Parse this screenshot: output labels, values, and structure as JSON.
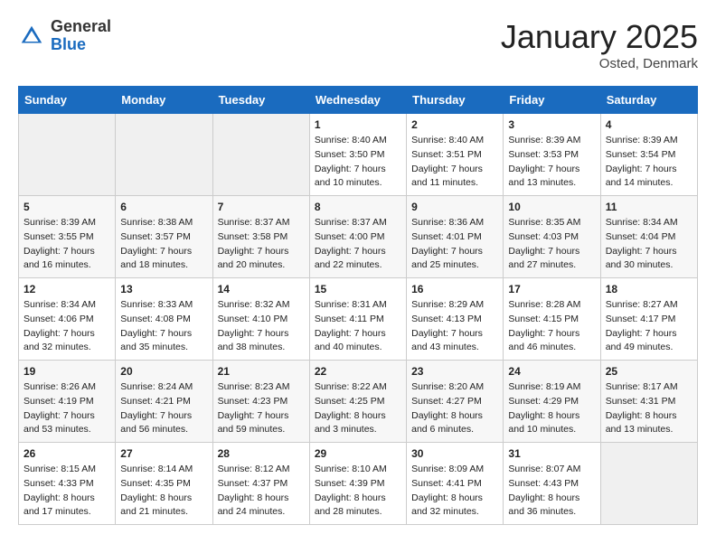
{
  "header": {
    "logo_general": "General",
    "logo_blue": "Blue",
    "month_title": "January 2025",
    "location": "Osted, Denmark"
  },
  "weekdays": [
    "Sunday",
    "Monday",
    "Tuesday",
    "Wednesday",
    "Thursday",
    "Friday",
    "Saturday"
  ],
  "weeks": [
    [
      {
        "day": "",
        "sunrise": "",
        "sunset": "",
        "daylight": ""
      },
      {
        "day": "",
        "sunrise": "",
        "sunset": "",
        "daylight": ""
      },
      {
        "day": "",
        "sunrise": "",
        "sunset": "",
        "daylight": ""
      },
      {
        "day": "1",
        "sunrise": "Sunrise: 8:40 AM",
        "sunset": "Sunset: 3:50 PM",
        "daylight": "Daylight: 7 hours and 10 minutes."
      },
      {
        "day": "2",
        "sunrise": "Sunrise: 8:40 AM",
        "sunset": "Sunset: 3:51 PM",
        "daylight": "Daylight: 7 hours and 11 minutes."
      },
      {
        "day": "3",
        "sunrise": "Sunrise: 8:39 AM",
        "sunset": "Sunset: 3:53 PM",
        "daylight": "Daylight: 7 hours and 13 minutes."
      },
      {
        "day": "4",
        "sunrise": "Sunrise: 8:39 AM",
        "sunset": "Sunset: 3:54 PM",
        "daylight": "Daylight: 7 hours and 14 minutes."
      }
    ],
    [
      {
        "day": "5",
        "sunrise": "Sunrise: 8:39 AM",
        "sunset": "Sunset: 3:55 PM",
        "daylight": "Daylight: 7 hours and 16 minutes."
      },
      {
        "day": "6",
        "sunrise": "Sunrise: 8:38 AM",
        "sunset": "Sunset: 3:57 PM",
        "daylight": "Daylight: 7 hours and 18 minutes."
      },
      {
        "day": "7",
        "sunrise": "Sunrise: 8:37 AM",
        "sunset": "Sunset: 3:58 PM",
        "daylight": "Daylight: 7 hours and 20 minutes."
      },
      {
        "day": "8",
        "sunrise": "Sunrise: 8:37 AM",
        "sunset": "Sunset: 4:00 PM",
        "daylight": "Daylight: 7 hours and 22 minutes."
      },
      {
        "day": "9",
        "sunrise": "Sunrise: 8:36 AM",
        "sunset": "Sunset: 4:01 PM",
        "daylight": "Daylight: 7 hours and 25 minutes."
      },
      {
        "day": "10",
        "sunrise": "Sunrise: 8:35 AM",
        "sunset": "Sunset: 4:03 PM",
        "daylight": "Daylight: 7 hours and 27 minutes."
      },
      {
        "day": "11",
        "sunrise": "Sunrise: 8:34 AM",
        "sunset": "Sunset: 4:04 PM",
        "daylight": "Daylight: 7 hours and 30 minutes."
      }
    ],
    [
      {
        "day": "12",
        "sunrise": "Sunrise: 8:34 AM",
        "sunset": "Sunset: 4:06 PM",
        "daylight": "Daylight: 7 hours and 32 minutes."
      },
      {
        "day": "13",
        "sunrise": "Sunrise: 8:33 AM",
        "sunset": "Sunset: 4:08 PM",
        "daylight": "Daylight: 7 hours and 35 minutes."
      },
      {
        "day": "14",
        "sunrise": "Sunrise: 8:32 AM",
        "sunset": "Sunset: 4:10 PM",
        "daylight": "Daylight: 7 hours and 38 minutes."
      },
      {
        "day": "15",
        "sunrise": "Sunrise: 8:31 AM",
        "sunset": "Sunset: 4:11 PM",
        "daylight": "Daylight: 7 hours and 40 minutes."
      },
      {
        "day": "16",
        "sunrise": "Sunrise: 8:29 AM",
        "sunset": "Sunset: 4:13 PM",
        "daylight": "Daylight: 7 hours and 43 minutes."
      },
      {
        "day": "17",
        "sunrise": "Sunrise: 8:28 AM",
        "sunset": "Sunset: 4:15 PM",
        "daylight": "Daylight: 7 hours and 46 minutes."
      },
      {
        "day": "18",
        "sunrise": "Sunrise: 8:27 AM",
        "sunset": "Sunset: 4:17 PM",
        "daylight": "Daylight: 7 hours and 49 minutes."
      }
    ],
    [
      {
        "day": "19",
        "sunrise": "Sunrise: 8:26 AM",
        "sunset": "Sunset: 4:19 PM",
        "daylight": "Daylight: 7 hours and 53 minutes."
      },
      {
        "day": "20",
        "sunrise": "Sunrise: 8:24 AM",
        "sunset": "Sunset: 4:21 PM",
        "daylight": "Daylight: 7 hours and 56 minutes."
      },
      {
        "day": "21",
        "sunrise": "Sunrise: 8:23 AM",
        "sunset": "Sunset: 4:23 PM",
        "daylight": "Daylight: 7 hours and 59 minutes."
      },
      {
        "day": "22",
        "sunrise": "Sunrise: 8:22 AM",
        "sunset": "Sunset: 4:25 PM",
        "daylight": "Daylight: 8 hours and 3 minutes."
      },
      {
        "day": "23",
        "sunrise": "Sunrise: 8:20 AM",
        "sunset": "Sunset: 4:27 PM",
        "daylight": "Daylight: 8 hours and 6 minutes."
      },
      {
        "day": "24",
        "sunrise": "Sunrise: 8:19 AM",
        "sunset": "Sunset: 4:29 PM",
        "daylight": "Daylight: 8 hours and 10 minutes."
      },
      {
        "day": "25",
        "sunrise": "Sunrise: 8:17 AM",
        "sunset": "Sunset: 4:31 PM",
        "daylight": "Daylight: 8 hours and 13 minutes."
      }
    ],
    [
      {
        "day": "26",
        "sunrise": "Sunrise: 8:15 AM",
        "sunset": "Sunset: 4:33 PM",
        "daylight": "Daylight: 8 hours and 17 minutes."
      },
      {
        "day": "27",
        "sunrise": "Sunrise: 8:14 AM",
        "sunset": "Sunset: 4:35 PM",
        "daylight": "Daylight: 8 hours and 21 minutes."
      },
      {
        "day": "28",
        "sunrise": "Sunrise: 8:12 AM",
        "sunset": "Sunset: 4:37 PM",
        "daylight": "Daylight: 8 hours and 24 minutes."
      },
      {
        "day": "29",
        "sunrise": "Sunrise: 8:10 AM",
        "sunset": "Sunset: 4:39 PM",
        "daylight": "Daylight: 8 hours and 28 minutes."
      },
      {
        "day": "30",
        "sunrise": "Sunrise: 8:09 AM",
        "sunset": "Sunset: 4:41 PM",
        "daylight": "Daylight: 8 hours and 32 minutes."
      },
      {
        "day": "31",
        "sunrise": "Sunrise: 8:07 AM",
        "sunset": "Sunset: 4:43 PM",
        "daylight": "Daylight: 8 hours and 36 minutes."
      },
      {
        "day": "",
        "sunrise": "",
        "sunset": "",
        "daylight": ""
      }
    ]
  ]
}
